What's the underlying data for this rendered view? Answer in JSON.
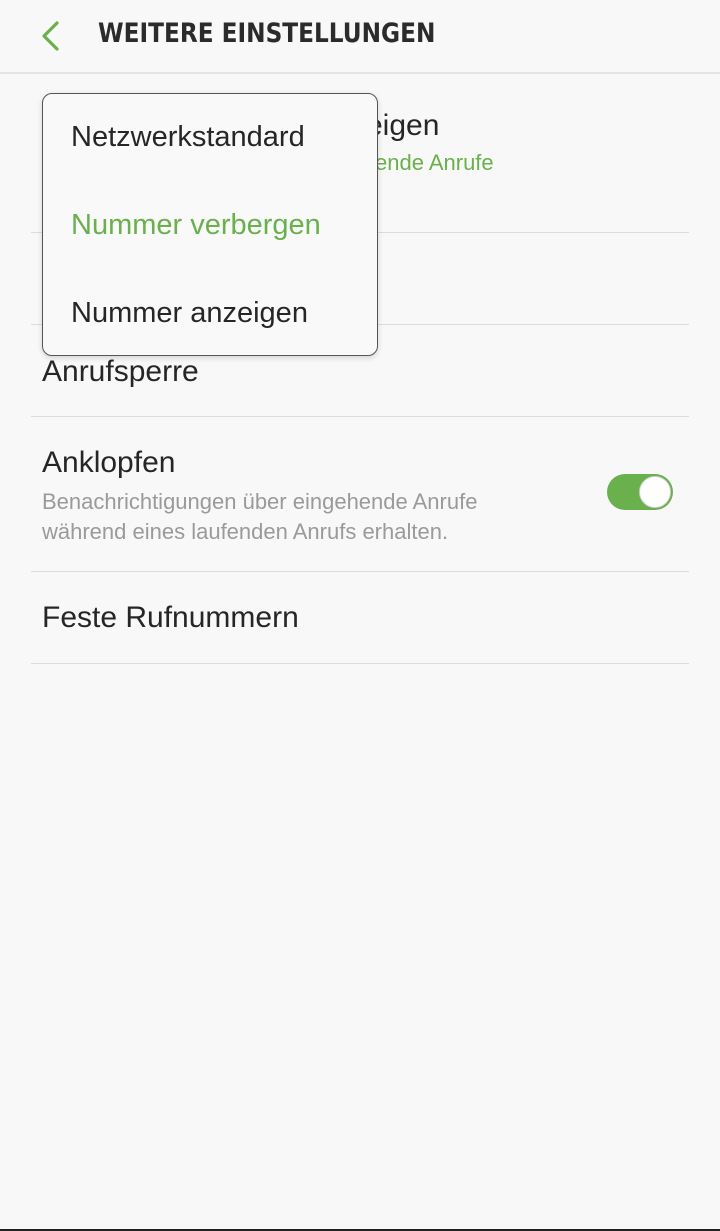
{
  "header": {
    "title": "WEITERE EINSTELLUNGEN"
  },
  "colors": {
    "accent": "#6ab04c",
    "text": "#262626",
    "subtext": "#9a9a9a",
    "background": "#f8f8f8"
  },
  "settings": {
    "caller_id": {
      "title_visible_part": "zeigen",
      "subtitle_visible_part": "ende Anrufe"
    },
    "call_barring": {
      "title": "Anrufsperre"
    },
    "call_waiting": {
      "title": "Anklopfen",
      "subtitle": "Benachrichtigungen über eingehende Anrufe während eines laufenden Anrufs erhalten.",
      "enabled": true
    },
    "fixed_dialing": {
      "title": "Feste Rufnummern"
    }
  },
  "popup": {
    "options": [
      {
        "label": "Netzwerkstandard",
        "selected": false
      },
      {
        "label": "Nummer verbergen",
        "selected": true
      },
      {
        "label": "Nummer anzeigen",
        "selected": false
      }
    ]
  }
}
